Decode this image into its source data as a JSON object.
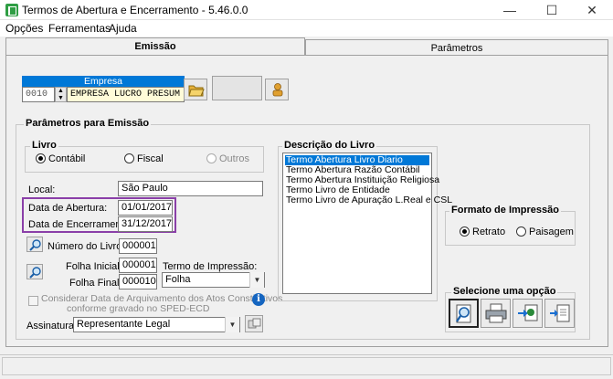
{
  "window": {
    "title": "Termos de Abertura e Encerramento - 5.46.0.0",
    "minimize": "—",
    "maximize": "☐",
    "close": "✕"
  },
  "menu": [
    "Opções",
    "Ferramentas",
    "Ajuda"
  ],
  "tabs": {
    "emissao": "Emissão",
    "parametros": "Parâmetros"
  },
  "empresa": {
    "label": "Empresa",
    "code": "0010",
    "name": "EMPRESA LUCRO PRESUM"
  },
  "params": {
    "title": "Parâmetros para Emissão",
    "livro": {
      "title": "Livro",
      "options": [
        "Contábil",
        "Fiscal",
        "Outros"
      ],
      "selected": "Contábil"
    },
    "local_label": "Local:",
    "local_value": "São Paulo",
    "data_abertura_label": "Data de Abertura:",
    "data_abertura_value": "01/01/2017",
    "data_encerramento_label": "Data de Encerramento:",
    "data_encerramento_value": "31/12/2017",
    "numero_livro_label": "Número do Livro:",
    "numero_livro_value": "000001",
    "folha_inicial_label": "Folha Inicial:",
    "folha_inicial_value": "000001",
    "folha_final_label": "Folha Final:",
    "folha_final_value": "000010",
    "termo_impressao_label": "Termo de Impressão:",
    "termo_impressao_value": "Folha",
    "considerar_label_1": "Considerar Data de Arquivamento dos Atos Constitutivos",
    "considerar_label_2": "conforme gravado no SPED-ECD",
    "assinatura_label": "Assinatura:",
    "assinatura_value": "Representante Legal"
  },
  "descricao": {
    "title": "Descrição do Livro",
    "items": [
      "Termo Abertura Livro Diario",
      "Termo Abertura Razão Contábil",
      "Termo Abertura Instituição Religiosa",
      "Termo Livro de Entidade",
      "Termo Livro de Apuração L.Real e CSL"
    ],
    "selected_index": 0
  },
  "formato": {
    "title": "Formato de Impressão",
    "options": [
      "Retrato",
      "Paisagem"
    ],
    "selected": "Retrato"
  },
  "opcoes": {
    "title": "Selecione uma opção"
  },
  "colors": {
    "highlight": "#8a3fa8",
    "empresa_header": "#0078d7",
    "selection": "#0078d7"
  }
}
